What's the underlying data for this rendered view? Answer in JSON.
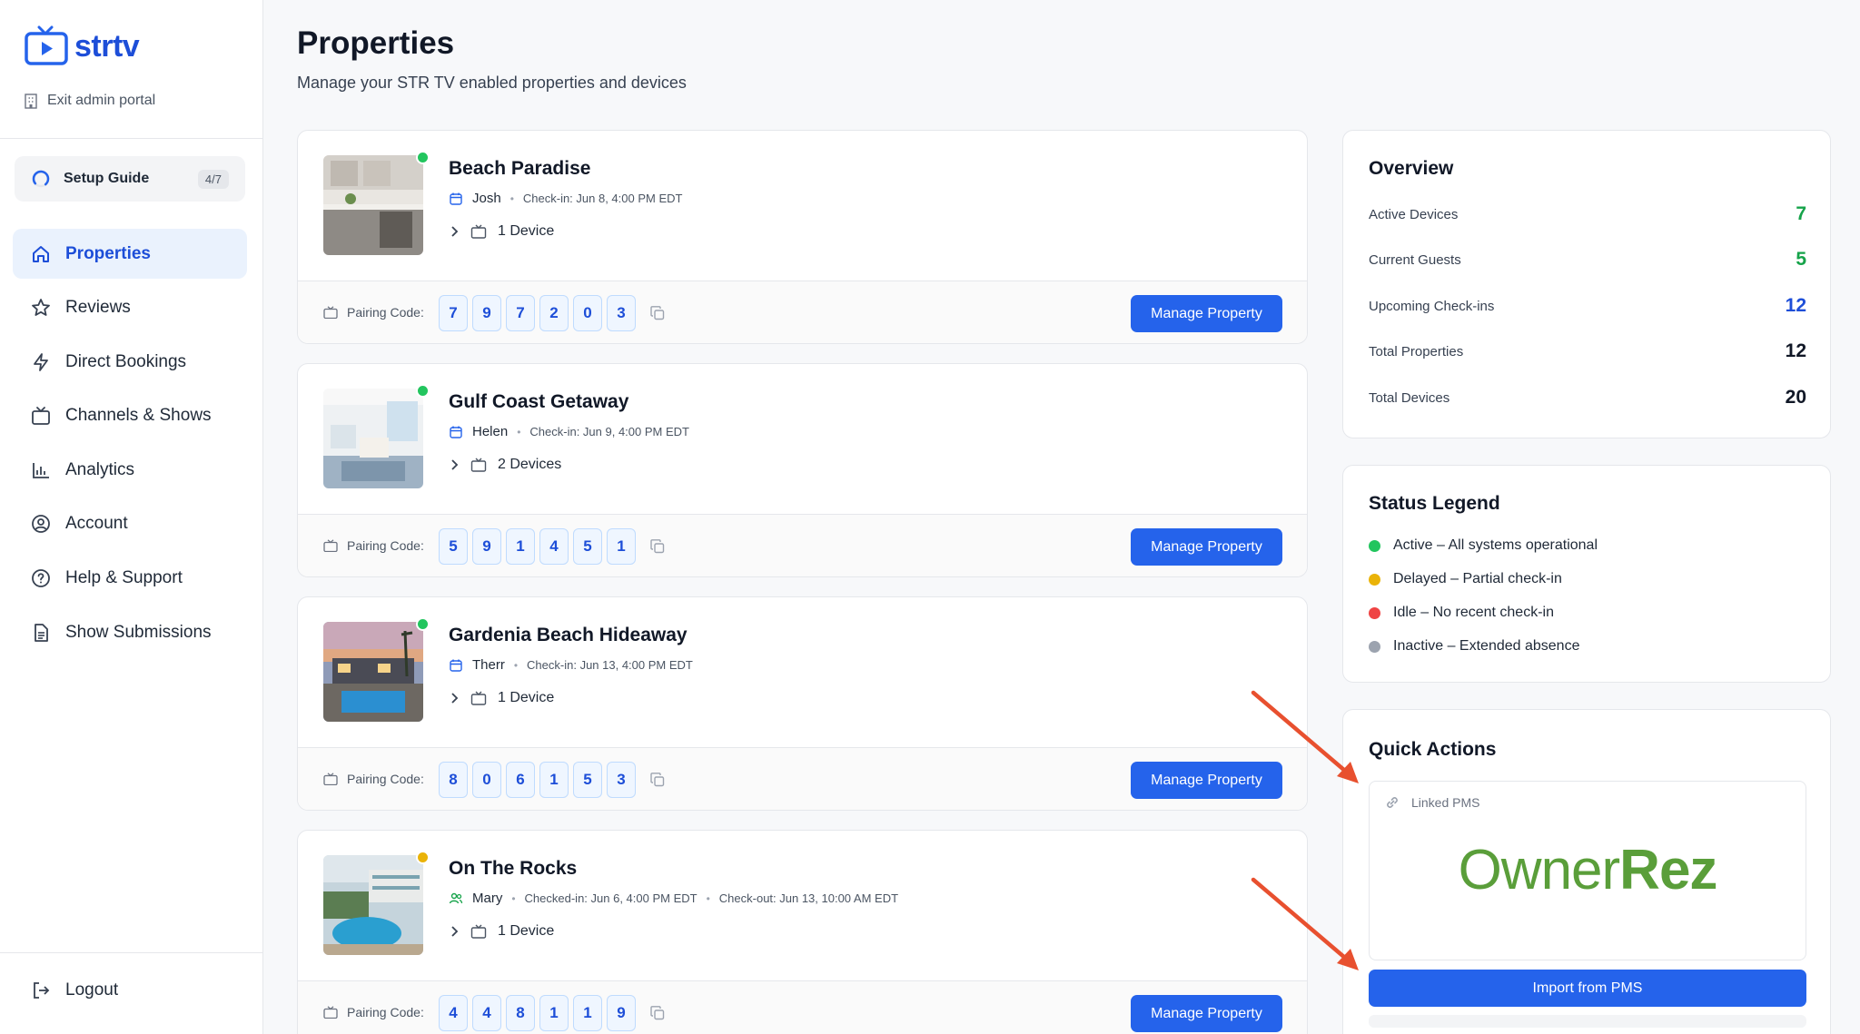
{
  "brand": {
    "name": "strtv"
  },
  "sidebar": {
    "exit_label": "Exit admin portal",
    "setup_guide": {
      "label": "Setup Guide",
      "progress": "4/7"
    },
    "items": [
      {
        "label": "Properties",
        "icon": "home-icon",
        "active": true
      },
      {
        "label": "Reviews",
        "icon": "star-icon"
      },
      {
        "label": "Direct Bookings",
        "icon": "bolt-icon"
      },
      {
        "label": "Channels & Shows",
        "icon": "tv-icon"
      },
      {
        "label": "Analytics",
        "icon": "chart-icon"
      },
      {
        "label": "Account",
        "icon": "user-circle-icon"
      },
      {
        "label": "Help & Support",
        "icon": "help-icon"
      },
      {
        "label": "Show Submissions",
        "icon": "document-icon"
      }
    ],
    "logout_label": "Logout"
  },
  "header": {
    "title": "Properties",
    "subtitle": "Manage your STR TV enabled properties and devices"
  },
  "properties": [
    {
      "name": "Beach Paradise",
      "status_color": "#22c55e",
      "guest": "Josh",
      "checkin": "Check-in: Jun 8, 4:00 PM EDT",
      "devices": "1 Device",
      "pairing_label": "Pairing Code:",
      "code": [
        "7",
        "9",
        "7",
        "2",
        "0",
        "3"
      ],
      "button": "Manage Property"
    },
    {
      "name": "Gulf Coast Getaway",
      "status_color": "#22c55e",
      "guest": "Helen",
      "checkin": "Check-in: Jun 9, 4:00 PM EDT",
      "devices": "2 Devices",
      "pairing_label": "Pairing Code:",
      "code": [
        "5",
        "9",
        "1",
        "4",
        "5",
        "1"
      ],
      "button": "Manage Property"
    },
    {
      "name": "Gardenia Beach Hideaway",
      "status_color": "#22c55e",
      "guest": "Therr",
      "checkin": "Check-in: Jun 13, 4:00 PM EDT",
      "devices": "1 Device",
      "pairing_label": "Pairing Code:",
      "code": [
        "8",
        "0",
        "6",
        "1",
        "5",
        "3"
      ],
      "button": "Manage Property"
    },
    {
      "name": "On The Rocks",
      "status_color": "#eab308",
      "guest": "Mary",
      "checkin": "Checked-in: Jun 6, 4:00 PM EDT",
      "checkout": "Check-out: Jun 13, 10:00 AM EDT",
      "devices": "1 Device",
      "pairing_label": "Pairing Code:",
      "code": [
        "4",
        "4",
        "8",
        "1",
        "1",
        "9"
      ],
      "button": "Manage Property"
    }
  ],
  "overview": {
    "title": "Overview",
    "rows": [
      {
        "label": "Active Devices",
        "value": "7",
        "color": "#16a34a"
      },
      {
        "label": "Current Guests",
        "value": "5",
        "color": "#16a34a"
      },
      {
        "label": "Upcoming Check-ins",
        "value": "12",
        "color": "#1d4ed8"
      },
      {
        "label": "Total Properties",
        "value": "12",
        "color": "#111827"
      },
      {
        "label": "Total Devices",
        "value": "20",
        "color": "#111827"
      }
    ]
  },
  "legend": {
    "title": "Status Legend",
    "items": [
      {
        "label": "Active – All systems operational",
        "color": "#22c55e"
      },
      {
        "label": "Delayed – Partial check-in",
        "color": "#eab308"
      },
      {
        "label": "Idle – No recent check-in",
        "color": "#ef4444"
      },
      {
        "label": "Inactive – Extended absence",
        "color": "#9ca3af"
      }
    ]
  },
  "quick_actions": {
    "title": "Quick Actions",
    "linked_label": "Linked PMS",
    "pms_logo_regular": "Owner",
    "pms_logo_bold": "Rez",
    "import_label": "Import from PMS"
  }
}
